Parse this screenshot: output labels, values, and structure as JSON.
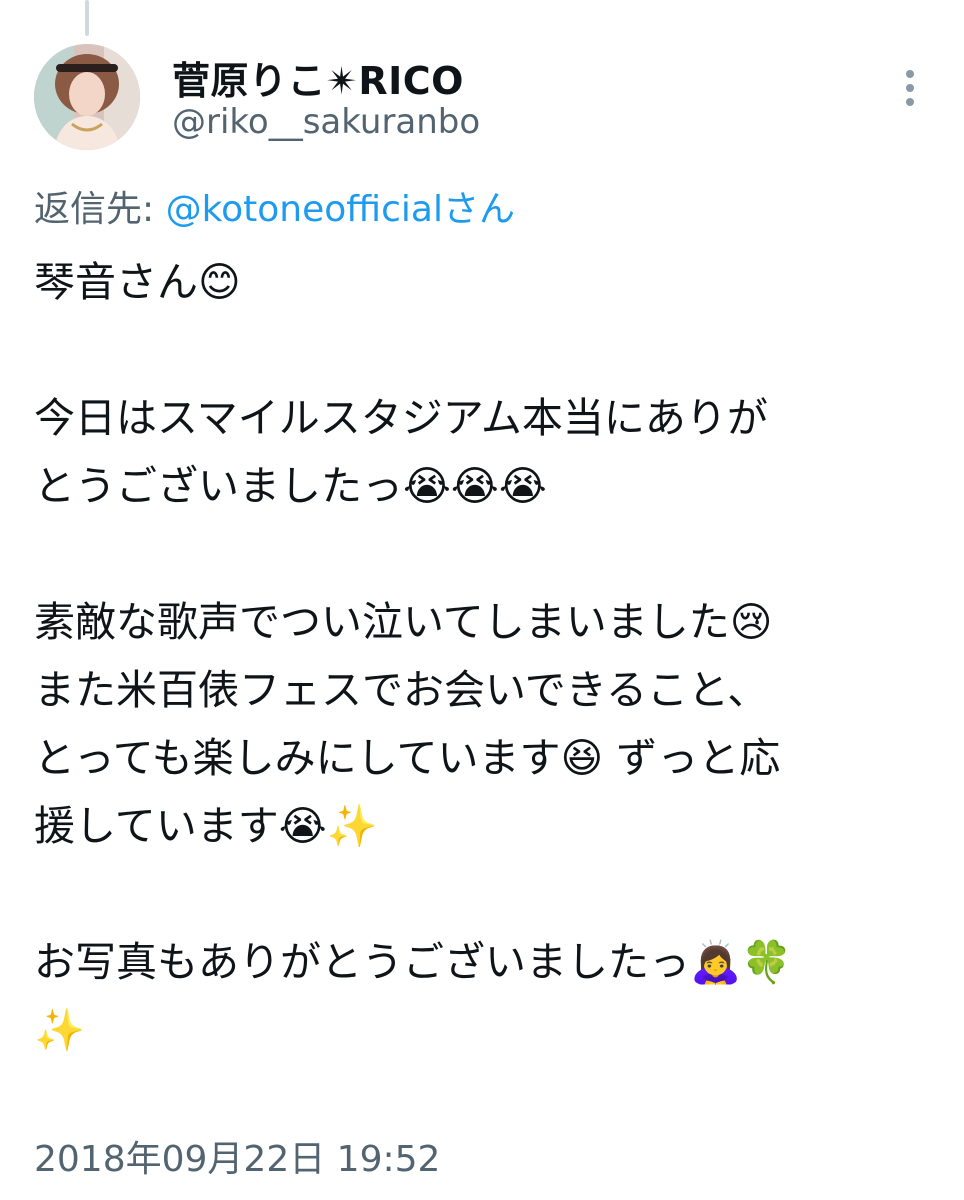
{
  "author": {
    "display_name": "菅原りこ✴RICO",
    "handle": "@riko__sakuranbo",
    "avatar": "profile-photo"
  },
  "reply": {
    "prefix": "返信先: ",
    "target": "@kotoneofficialさん"
  },
  "tweet": {
    "lines": [
      "琴音さん😊",
      "",
      "今日はスマイルスタジアム本当にありが",
      "とうございましたっ😭😭😭",
      "",
      "素敵な歌声でつい泣いてしまいました😢",
      "また米百俵フェスでお会いできること、",
      "とっても楽しみにしています😆 ずっと応",
      "援しています😭✨",
      "",
      "お写真もありがとうございましたっ🙇‍♀️🍀",
      "✨"
    ]
  },
  "timestamp": "2018年09月22日 19:52",
  "icons": {
    "more": "more-vertical-icon"
  }
}
